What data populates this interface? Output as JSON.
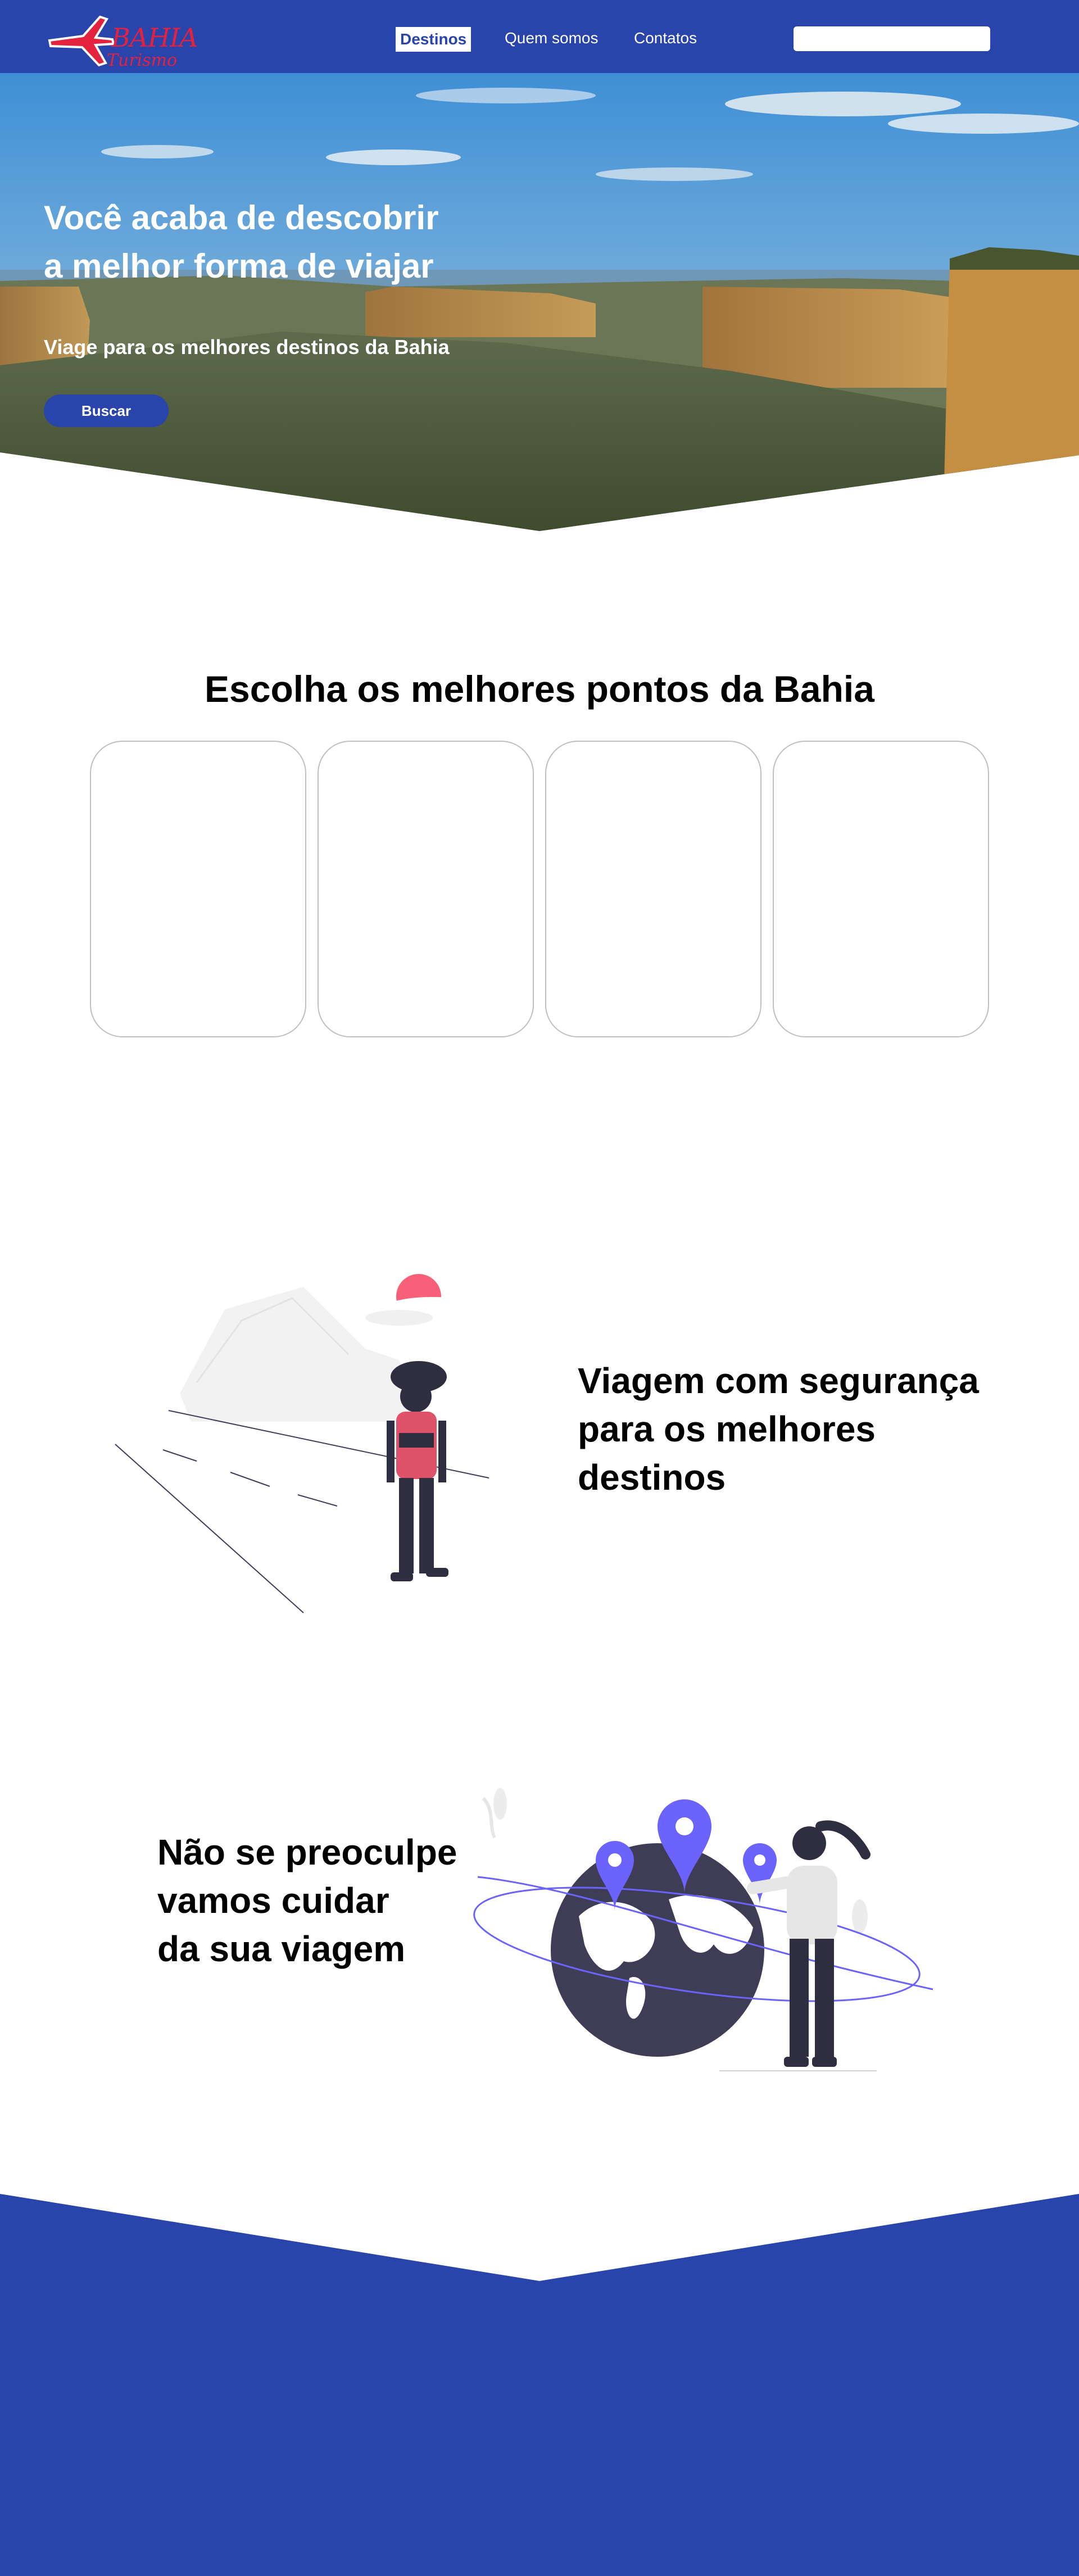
{
  "brand": {
    "logo_word": "BAHIA",
    "logo_sub": "Turismo",
    "logo_name": "airplane-logo-icon",
    "primary_color": "#2944aa",
    "accent_color": "#e5223e"
  },
  "nav": {
    "links": [
      {
        "label": "Destinos",
        "active": true
      },
      {
        "label": "Quem somos",
        "active": false
      },
      {
        "label": "Contatos",
        "active": false
      }
    ],
    "search_placeholder": ""
  },
  "hero": {
    "title": "Você acaba de descobrir\na melhor forma de viajar",
    "subtitle": "Viage para os melhores destinos da Bahia",
    "button_label": "Buscar"
  },
  "destinations": {
    "title": "Escolha os melhores pontos da Bahia",
    "cards": [
      "",
      "",
      "",
      ""
    ]
  },
  "features": [
    {
      "text": "Viagem com segurança\npara os melhores\ndestinos",
      "illustration": "traveler-backpack-illustration"
    },
    {
      "text": "Não se preoculpe\nvamos cuidar\nda sua viagem",
      "illustration": "world-map-pins-illustration"
    }
  ]
}
